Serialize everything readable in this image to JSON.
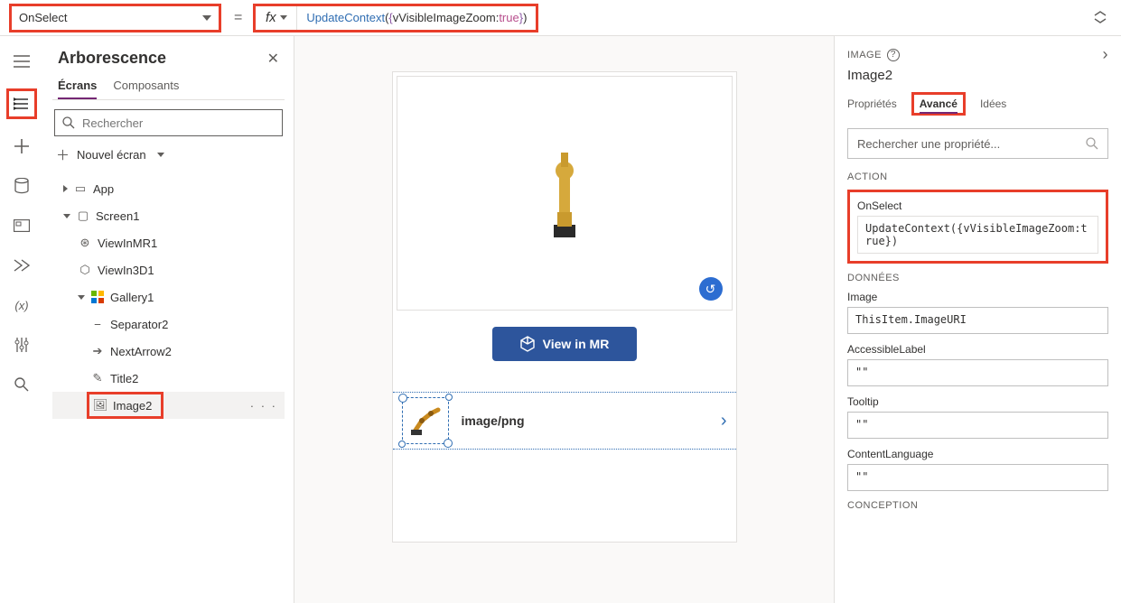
{
  "formula_bar": {
    "property": "OnSelect",
    "equals": "=",
    "fx": "fx",
    "formula_html": "<span class='fn'>UpdateContext</span><span class='paren'>(</span><span class='brace'>{</span><span class='ident'>vVisibleImageZoom</span><span class='paren'>:</span><span class='bool'>true</span><span class='brace'>}</span><span class='paren'>)</span>"
  },
  "rail": {
    "hamburger": "≡",
    "layers": "⧉",
    "plus": "+",
    "data": "🗄",
    "media": "⎚",
    "advanced": "⫻",
    "var": "(x)",
    "settings": "⎎",
    "search": "⌕"
  },
  "tree": {
    "title": "Arborescence",
    "tabs": {
      "screens": "Écrans",
      "components": "Composants"
    },
    "search_placeholder": "Rechercher",
    "new_screen": "Nouvel écran",
    "nodes": {
      "app": "App",
      "screen1": "Screen1",
      "viewinmr1": "ViewInMR1",
      "viewin3d1": "ViewIn3D1",
      "gallery1": "Gallery1",
      "separator2": "Separator2",
      "nextarrow2": "NextArrow2",
      "title2": "Title2",
      "image2": "Image2"
    }
  },
  "canvas": {
    "view_in_mr": "View in MR",
    "row_text": "image/png"
  },
  "right": {
    "head": "IMAGE",
    "title": "Image2",
    "tabs": {
      "properties": "Propriétés",
      "advanced": "Avancé",
      "ideas": "Idées"
    },
    "search_placeholder": "Rechercher une propriété...",
    "sections": {
      "action": "ACTION",
      "data": "DONNÉES",
      "design": "CONCEPTION"
    },
    "props": {
      "onselect_label": "OnSelect",
      "onselect_value": "UpdateContext({vVisibleImageZoom:true})",
      "image_label": "Image",
      "image_value": "ThisItem.ImageURI",
      "accessiblelabel_label": "AccessibleLabel",
      "accessiblelabel_value": "\"\"",
      "tooltip_label": "Tooltip",
      "tooltip_value": "\"\"",
      "contentlanguage_label": "ContentLanguage",
      "contentlanguage_value": "\"\""
    }
  }
}
